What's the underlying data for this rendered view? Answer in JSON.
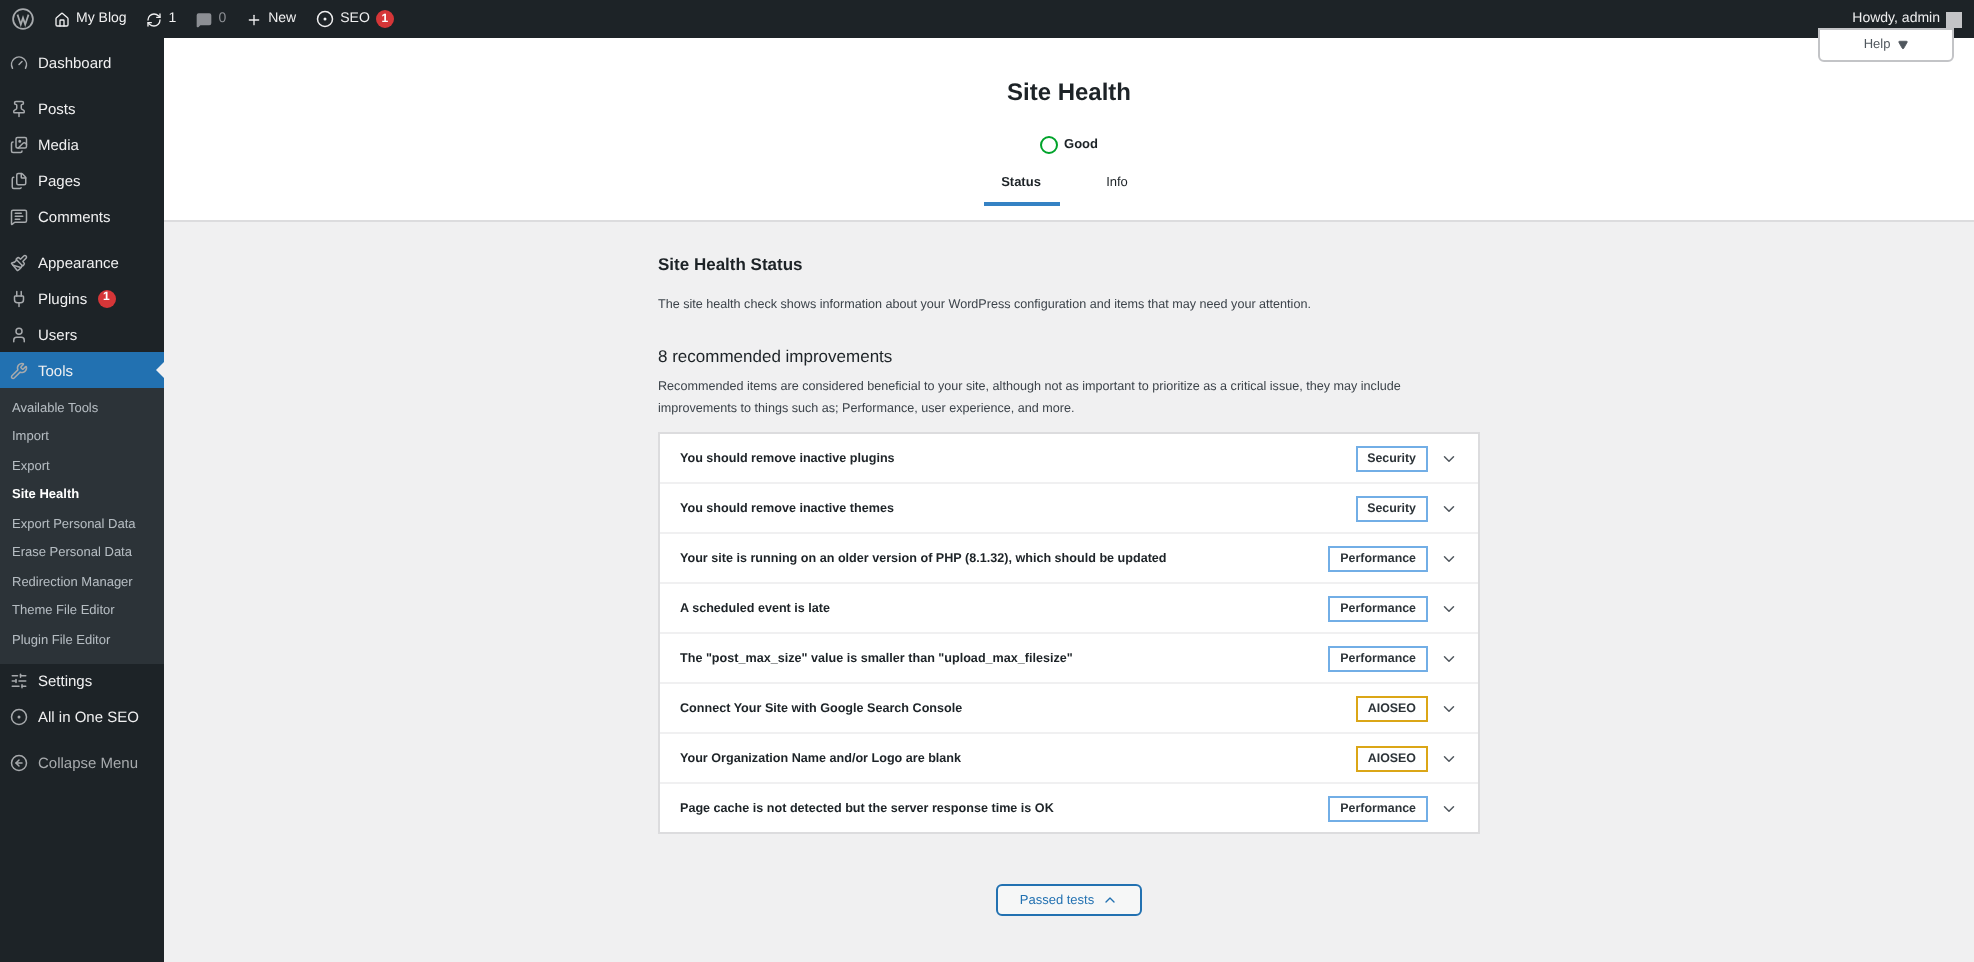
{
  "admin_bar": {
    "site": "My Blog",
    "updates": "1",
    "comments": "0",
    "new": "New",
    "seo": {
      "label": "SEO",
      "badge": "1"
    },
    "greeting": "Howdy, admin"
  },
  "sidebar": {
    "groups": [
      {
        "items": [
          {
            "label": "Dashboard",
            "kind": "dashboard",
            "selected": false
          }
        ]
      },
      {
        "items": [
          {
            "label": "Posts",
            "kind": "pin",
            "selected": false
          },
          {
            "label": "Media",
            "kind": "media",
            "selected": false
          },
          {
            "label": "Pages",
            "kind": "pages",
            "selected": false
          },
          {
            "label": "Comments",
            "kind": "comments",
            "selected": false
          }
        ]
      },
      {
        "items": [
          {
            "label": "Appearance",
            "kind": "brush",
            "selected": false
          },
          {
            "label": "Plugins",
            "kind": "plug",
            "selected": false,
            "badge": "1"
          },
          {
            "label": "Users",
            "kind": "user",
            "selected": false
          },
          {
            "label": "Tools",
            "kind": "wrench",
            "selected": true,
            "submenu": [
              {
                "label": "Available Tools",
                "selected": false
              },
              {
                "label": "Import",
                "selected": false
              },
              {
                "label": "Export",
                "selected": false
              },
              {
                "label": "Site Health",
                "selected": true
              },
              {
                "label": "Export Personal Data",
                "selected": false
              },
              {
                "label": "Erase Personal Data",
                "selected": false
              },
              {
                "label": "Redirection Manager",
                "selected": false
              },
              {
                "label": "Theme File Editor",
                "selected": false
              },
              {
                "label": "Plugin File Editor",
                "selected": false
              }
            ]
          },
          {
            "label": "Settings",
            "kind": "settings",
            "selected": false
          },
          {
            "label": "All in One SEO",
            "kind": "seo",
            "selected": false
          }
        ]
      },
      {
        "items": [
          {
            "label": "Collapse Menu",
            "kind": "collapse",
            "selected": false
          }
        ]
      }
    ]
  },
  "help_button": "Help",
  "header": {
    "title": "Site Health",
    "status": "Good",
    "tabs": [
      {
        "label": "Status",
        "selected": true
      },
      {
        "label": "Info",
        "selected": false
      }
    ]
  },
  "content": {
    "heading": "Site Health Status",
    "intro": "The site health check shows information about your WordPress configuration and items that may need your attention.",
    "subheading": "8 recommended improvements",
    "description": "Recommended items are considered beneficial to your site, although not as important to prioritize as a critical issue, they may include improvements to things such as; Performance, user experience, and more.",
    "issues": [
      {
        "title": "You should remove inactive plugins",
        "tag": "Security",
        "color": "#72aee6"
      },
      {
        "title": "You should remove inactive themes",
        "tag": "Security",
        "color": "#72aee6"
      },
      {
        "title": "Your site is running on an older version of PHP (8.1.32), which should be updated",
        "tag": "Performance",
        "color": "#72aee6"
      },
      {
        "title": "A scheduled event is late",
        "tag": "Performance",
        "color": "#72aee6"
      },
      {
        "title": "The \"post_max_size\" value is smaller than \"upload_max_filesize\"",
        "tag": "Performance",
        "color": "#72aee6"
      },
      {
        "title": "Connect Your Site with Google Search Console",
        "tag": "AIOSEO",
        "color": "#dba617"
      },
      {
        "title": "Your Organization Name and/or Logo are blank",
        "tag": "AIOSEO",
        "color": "#dba617"
      },
      {
        "title": "Page cache is not detected but the server response time is OK",
        "tag": "Performance",
        "color": "#72aee6"
      }
    ],
    "passed_button": "Passed tests"
  }
}
